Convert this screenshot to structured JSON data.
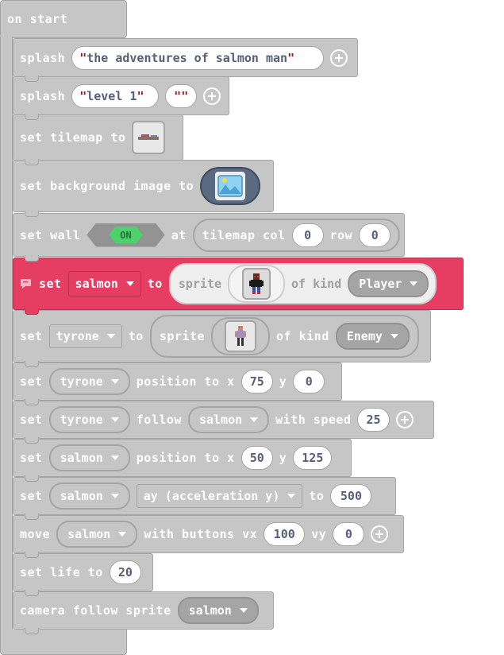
{
  "hat": {
    "label": "on start"
  },
  "splash1": {
    "label": "splash",
    "text": "the adventures of salmon man"
  },
  "splash2": {
    "label": "splash",
    "text": "level 1",
    "text2": ""
  },
  "tilemap": {
    "label": "set tilemap to"
  },
  "background": {
    "label": "set background image to"
  },
  "wall": {
    "label": "set wall",
    "state": "ON",
    "at": "at",
    "tilemap": "tilemap col",
    "col": "0",
    "row_label": "row",
    "row": "0"
  },
  "salmon": {
    "set": "set",
    "var": "salmon",
    "to": "to",
    "sprite": "sprite",
    "kind_label": "of kind",
    "kind": "Player"
  },
  "tyrone": {
    "set": "set",
    "var": "tyrone",
    "to": "to",
    "sprite": "sprite",
    "kind_label": "of kind",
    "kind": "Enemy"
  },
  "tyrone_pos": {
    "set": "set",
    "var": "tyrone",
    "label": "position to x",
    "x": "75",
    "y_label": "y",
    "y": "0"
  },
  "follow": {
    "set": "set",
    "var": "tyrone",
    "label": "follow",
    "target": "salmon",
    "speed_label": "with speed",
    "speed": "25"
  },
  "salmon_pos": {
    "set": "set",
    "var": "salmon",
    "label": "position to x",
    "x": "50",
    "y_label": "y",
    "y": "125"
  },
  "accel": {
    "set": "set",
    "var": "salmon",
    "prop": "ay (acceleration y)",
    "to": "to",
    "value": "500"
  },
  "move": {
    "label": "move",
    "var": "salmon",
    "buttons": "with buttons vx",
    "vx": "100",
    "vy_label": "vy",
    "vy": "0"
  },
  "life": {
    "label": "set life to",
    "value": "20"
  },
  "camera": {
    "label": "camera follow sprite",
    "var": "salmon"
  },
  "colors": {
    "block": "#c6c6c6",
    "border": "#a5a5a5",
    "sprites": "#e63e62",
    "on": "#4bd26a"
  },
  "icons": [
    "plus-icon",
    "dropdown-caret-icon",
    "comment-icon",
    "image-icon"
  ]
}
